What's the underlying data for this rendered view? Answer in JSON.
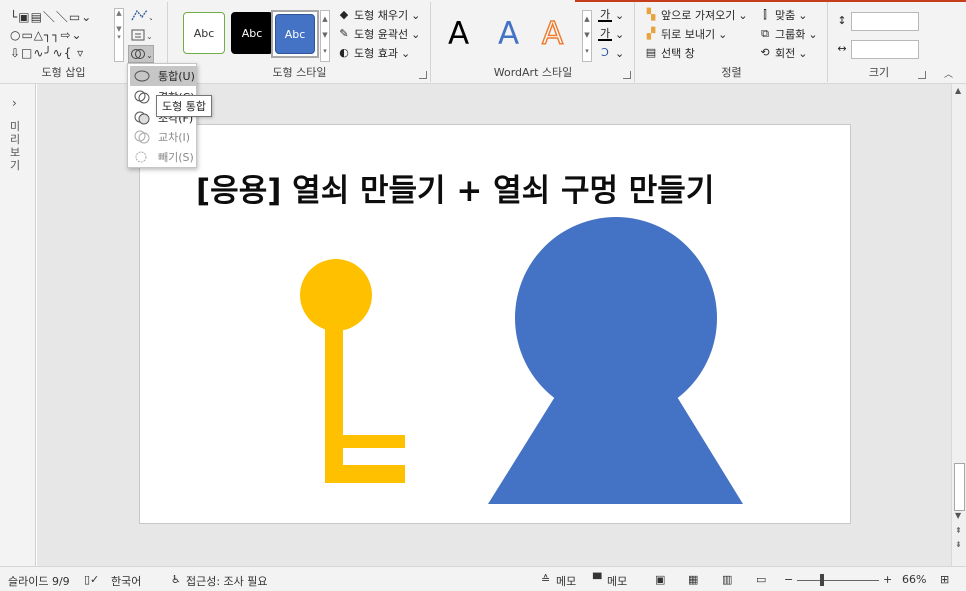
{
  "ribbon": {
    "insert_shapes": {
      "label": "도형 삽입",
      "shape_glyphs": "└▣▤＼＼▭⌄\n○▭△┐┐⇨⌄\n⇩□∿╯∿{ ▿"
    },
    "shape_styles": {
      "label": "도형 스타일",
      "presets": [
        {
          "text": "Abc",
          "bg": "#ffffff",
          "fg": "#333333",
          "border": "#70ad47"
        },
        {
          "text": "Abc",
          "bg": "#000000",
          "fg": "#ffffff",
          "border": "#000000"
        },
        {
          "text": "Abc",
          "bg": "#4472c4",
          "fg": "#ffffff",
          "border": "#2f5597"
        }
      ],
      "fill_label": "도형 채우기",
      "outline_label": "도형 윤곽선",
      "effects_label": "도형 효과"
    },
    "wordart": {
      "label": "WordArt 스타일",
      "letters": [
        "A",
        "A",
        "A"
      ],
      "text_fill_glyph": "가",
      "text_outline_glyph": "가"
    },
    "arrange": {
      "label": "정렬",
      "bring_forward": "앞으로 가져오기",
      "send_backward": "뒤로 보내기",
      "selection_pane": "선택 창",
      "align": "맞춤",
      "group": "그룹화",
      "rotate": "회전"
    },
    "size": {
      "label": "크기",
      "height_value": "",
      "width_value": ""
    }
  },
  "merge_menu": {
    "items": [
      {
        "label": "통합(U)",
        "state": "highlighted"
      },
      {
        "label": "결합(C)",
        "state": "normal"
      },
      {
        "label": "조각(F)",
        "state": "normal"
      },
      {
        "label": "교차(I)",
        "state": "disabled"
      },
      {
        "label": "빼기(S)",
        "state": "disabled"
      }
    ],
    "tooltip": "도형 통합"
  },
  "left_pane": {
    "expand_glyph": "›",
    "label": "미리보기"
  },
  "slide": {
    "title": "[응용] 열쇠 만들기 + 열쇠 구멍 만들기",
    "key_color": "#ffc000",
    "keyhole_color": "#4472c4"
  },
  "status": {
    "slide_info": "슬라이드 9/9",
    "language": "한국어",
    "accessibility": "접근성: 조사 필요",
    "notes": "메모",
    "comments": "메모",
    "zoom": "66%"
  },
  "colors": {
    "accent": "#c43e1c",
    "ribbon_bg": "#f3f3f3",
    "canvas_bg": "#e7e7e7"
  }
}
